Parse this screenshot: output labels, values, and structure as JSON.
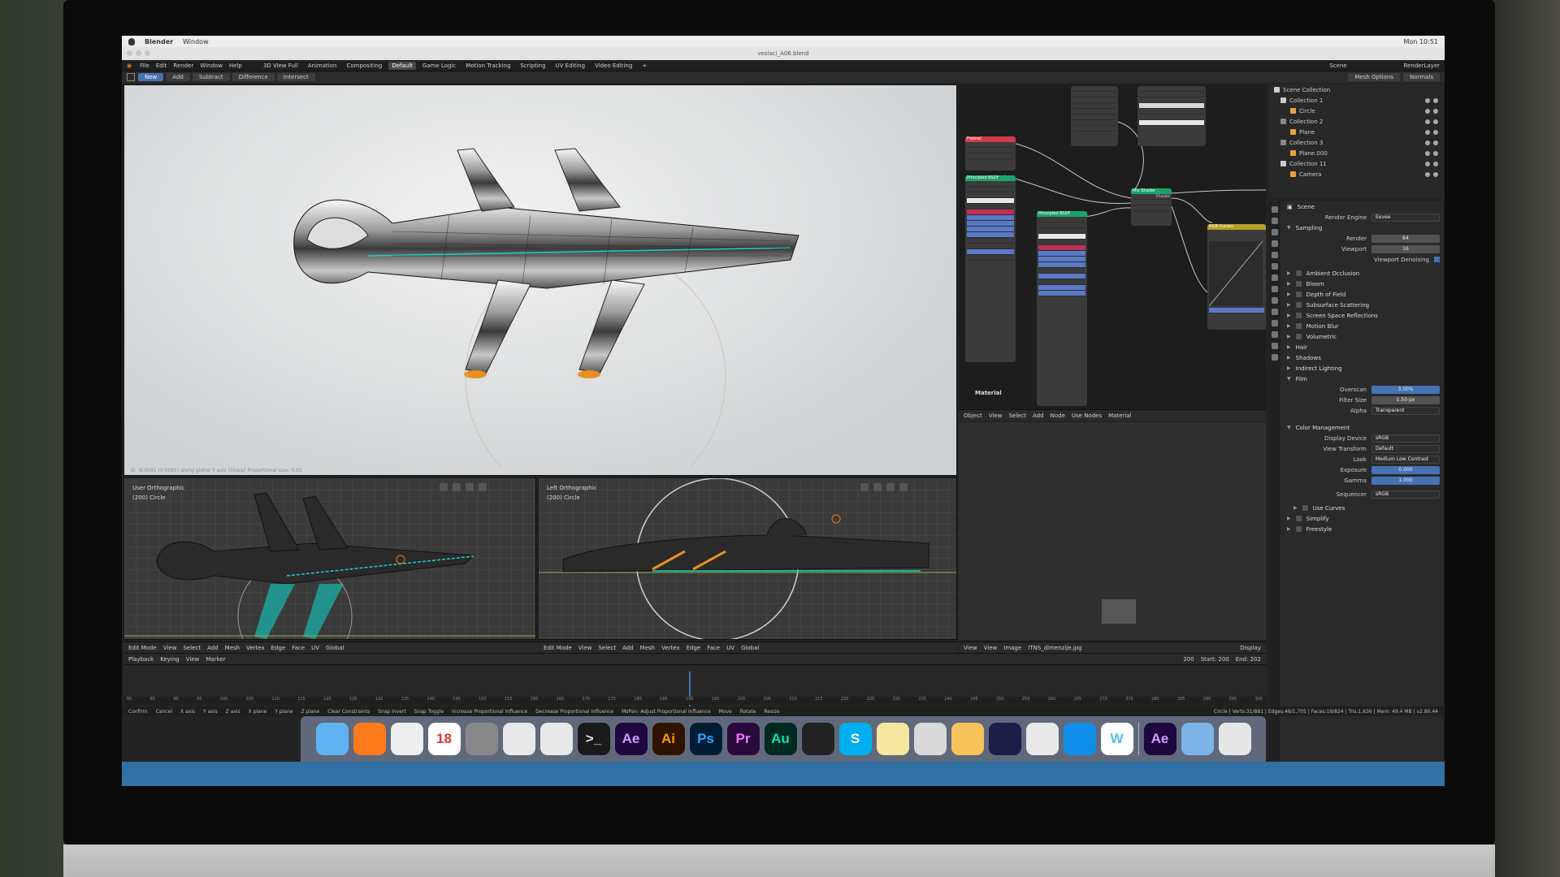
{
  "macbar": {
    "app": "Blender",
    "menu_window": "Window",
    "clock": "Mon 10:51"
  },
  "titlebar": {
    "title": "veslaci_A06.blend"
  },
  "topbar": {
    "menus": [
      "File",
      "Edit",
      "Render",
      "Window",
      "Help"
    ],
    "workspaces": [
      "3D View Full",
      "Animation",
      "Compositing",
      "Default",
      "Game Logic",
      "Motion Tracking",
      "Scripting",
      "UV Editing",
      "Video Editing",
      "+"
    ],
    "active_workspace": "Default",
    "scene_label": "Scene",
    "layer_label": "RenderLayer"
  },
  "toolrow": {
    "buttons": [
      "New",
      "Add",
      "Subtract",
      "Difference",
      "Intersect"
    ],
    "active": "New",
    "mesh_options": "Mesh Options",
    "normals": "Normals"
  },
  "viewport_main": {
    "footer": "D: -0.0091 (0.0091) along global Y axis (Sharp)   Proportional size: 0.01"
  },
  "viewport_left": {
    "name": "User Orthographic",
    "object": "(200) Circle"
  },
  "viewport_right": {
    "name": "Left Orthographic",
    "object": "(200) Circle"
  },
  "vp_header": {
    "mode": "Edit Mode",
    "items": [
      "View",
      "Select",
      "Add",
      "Mesh",
      "Vertex",
      "Edge",
      "Face",
      "UV"
    ],
    "orientation": "Global"
  },
  "node_editor": {
    "header": [
      "Object",
      "View",
      "Select",
      "Add",
      "Node",
      "Use Nodes",
      "Material"
    ],
    "material_label": "Material",
    "nodes": {
      "fresnel": "Fresnel",
      "principled1": "Principled BSDF",
      "principled2": "Principled BSDF",
      "mix": "Mix Shader",
      "rgb_curves": "RGB Curves",
      "mix_out": "Shader"
    }
  },
  "image_editor": {
    "header": [
      "View",
      "View",
      "Image"
    ],
    "image": "ITNS_dimenzije.jpg",
    "display": "Display"
  },
  "outliner": {
    "rows": [
      {
        "label": "Scene Collection",
        "color": "#cccccc"
      },
      {
        "label": "Collection 1",
        "color": "#cccccc"
      },
      {
        "label": "Circle",
        "color": "#e8a040"
      },
      {
        "label": "Collection 2",
        "color": "#888888"
      },
      {
        "label": "Plane",
        "color": "#e8a040"
      },
      {
        "label": "Collection 3",
        "color": "#888888"
      },
      {
        "label": "Plane.000",
        "color": "#e8a040"
      },
      {
        "label": "Collection 11",
        "color": "#cccccc"
      },
      {
        "label": "Camera",
        "color": "#e8a040"
      }
    ]
  },
  "properties": {
    "scene": "Scene",
    "render_engine_label": "Render Engine",
    "render_engine": "Eevee",
    "sampling": "Sampling",
    "render_label": "Render",
    "render_value": "64",
    "viewport_label": "Viewport",
    "viewport_value": "16",
    "viewport_denoising": "Viewport Denoising",
    "sections": [
      "Ambient Occlusion",
      "Bloom",
      "Depth of Field",
      "Subsurface Scattering",
      "Screen Space Reflections",
      "Motion Blur",
      "Volumetric",
      "Hair",
      "Shadows",
      "Indirect Lighting",
      "Film"
    ],
    "overscan_label": "Overscan",
    "overscan_value": "3.00%",
    "filter_label": "Filter Size",
    "filter_value": "1.50 px",
    "alpha_label": "Alpha",
    "alpha_value": "Transparent",
    "color_mgmt": "Color Management",
    "display_device_label": "Display Device",
    "display_device": "sRGB",
    "view_transform_label": "View Transform",
    "view_transform": "Default",
    "look_label": "Look",
    "look": "Medium Low Contrast",
    "exposure_label": "Exposure",
    "exposure": "0.000",
    "gamma_label": "Gamma",
    "gamma": "1.000",
    "sequencer_label": "Sequencer",
    "sequencer": "sRGB",
    "use_curves": "Use Curves",
    "simplify": "Simplify",
    "freestyle": "Freestyle"
  },
  "timeline": {
    "menus": [
      "Playback",
      "Keying",
      "View",
      "Marker"
    ],
    "current": "200",
    "start": "Start: 200",
    "end": "End: 202",
    "ruler": [
      "80",
      "85",
      "90",
      "95",
      "100",
      "105",
      "110",
      "115",
      "120",
      "125",
      "130",
      "135",
      "140",
      "145",
      "150",
      "155",
      "160",
      "165",
      "170",
      "175",
      "180",
      "185",
      "190",
      "195",
      "200",
      "205",
      "210",
      "215",
      "220",
      "225",
      "230",
      "235",
      "240",
      "245",
      "250",
      "255",
      "260",
      "265",
      "270",
      "275",
      "280",
      "285",
      "290",
      "295",
      "300"
    ]
  },
  "statusbar": {
    "items": [
      "Confirm",
      "Cancel",
      "X axis",
      "Y axis",
      "Z axis",
      "X plane",
      "Y plane",
      "Z plane",
      "Clear Constraints",
      "Snap Invert",
      "Snap Toggle",
      "Increase Proportional Influence",
      "Decrease Proportional Influence",
      "MsPan: Adjust Proportional Influence",
      "Move",
      "Rotate",
      "Resize"
    ],
    "stats": "Circle | Verts:31/881 | Edges:48/1,705 | Faces:19/824 | Tris:1,636 | Mem: 49.4 MB | v2.80.44"
  },
  "dock": {
    "apps": [
      {
        "name": "Finder",
        "text": "",
        "bg": "#5fb3f0",
        "fg": "#ffffff",
        "icon": "finder-icon"
      },
      {
        "name": "Firefox",
        "text": "",
        "bg": "#ff7a1a",
        "fg": "#ffffff",
        "icon": "firefox-icon"
      },
      {
        "name": "Chrome",
        "text": "",
        "bg": "#eeeeee",
        "fg": "#333333",
        "icon": "chrome-icon"
      },
      {
        "name": "Calendar",
        "text": "18",
        "bg": "#ffffff",
        "fg": "#e03030",
        "icon": "calendar-icon"
      },
      {
        "name": "System Preferences",
        "text": "",
        "bg": "#888888",
        "fg": "#ffffff",
        "icon": "settings-icon"
      },
      {
        "name": "Blender",
        "text": "",
        "bg": "#e8e8e8",
        "fg": "#e87d0d",
        "icon": "blender-icon"
      },
      {
        "name": "Blender 2",
        "text": "",
        "bg": "#e8e8e8",
        "fg": "#e87d0d",
        "icon": "blender-icon"
      },
      {
        "name": "Terminal",
        "text": ">_",
        "bg": "#1a1a1a",
        "fg": "#dddddd",
        "icon": "terminal-icon"
      },
      {
        "name": "After Effects",
        "text": "Ae",
        "bg": "#1f0740",
        "fg": "#d69dff",
        "icon": "after-effects-icon"
      },
      {
        "name": "Illustrator",
        "text": "Ai",
        "bg": "#2e1300",
        "fg": "#ff9a00",
        "icon": "illustrator-icon"
      },
      {
        "name": "Photoshop",
        "text": "Ps",
        "bg": "#001d34",
        "fg": "#31a8ff",
        "icon": "photoshop-icon"
      },
      {
        "name": "Premiere",
        "text": "Pr",
        "bg": "#2a0a3c",
        "fg": "#ea77ff",
        "icon": "premiere-icon"
      },
      {
        "name": "Audition",
        "text": "Au",
        "bg": "#00291f",
        "fg": "#00e4bb",
        "icon": "audition-icon"
      },
      {
        "name": "DaVinci",
        "text": "",
        "bg": "#222222",
        "fg": "#ffffff",
        "icon": "davinci-icon"
      },
      {
        "name": "Skype",
        "text": "S",
        "bg": "#00aff0",
        "fg": "#ffffff",
        "icon": "skype-icon"
      },
      {
        "name": "Notes",
        "text": "",
        "bg": "#f5e6a0",
        "fg": "#333333",
        "icon": "notes-icon"
      },
      {
        "name": "Preview",
        "text": "",
        "bg": "#d8d8d8",
        "fg": "#333333",
        "icon": "preview-icon"
      },
      {
        "name": "Sketch",
        "text": "",
        "bg": "#f7c25a",
        "fg": "#ffffff",
        "icon": "sketch-icon"
      },
      {
        "name": "DaVinci 2",
        "text": "",
        "bg": "#1d1d4a",
        "fg": "#ffffff",
        "icon": "chart-icon"
      },
      {
        "name": "VLC",
        "text": "",
        "bg": "#e8e8e8",
        "fg": "#ff8800",
        "icon": "vlc-icon"
      },
      {
        "name": "TeamViewer",
        "text": "",
        "bg": "#0e8ee9",
        "fg": "#ffffff",
        "icon": "teamviewer-icon"
      },
      {
        "name": "App",
        "text": "W",
        "bg": "#ffffff",
        "fg": "#55c0e8",
        "icon": "app-icon"
      }
    ],
    "right": [
      {
        "name": "Ae document",
        "text": "Ae",
        "bg": "#1f0740",
        "fg": "#d69dff",
        "icon": "ae-document-icon"
      },
      {
        "name": "Folder",
        "text": "",
        "bg": "#7cb4e8",
        "fg": "#ffffff",
        "icon": "folder-icon"
      },
      {
        "name": "Trash",
        "text": "",
        "bg": "#e6e6e6",
        "fg": "#999999",
        "icon": "trash-icon"
      }
    ]
  }
}
